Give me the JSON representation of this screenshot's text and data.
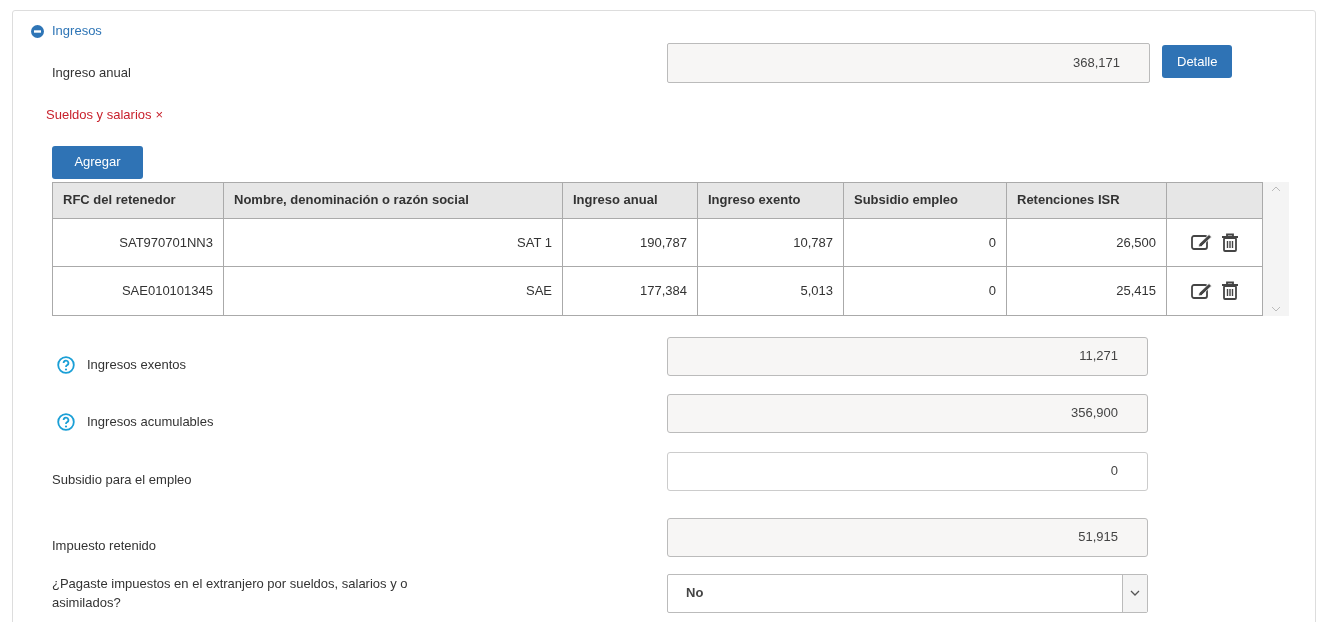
{
  "section": {
    "title": "Ingresos",
    "expanded": true
  },
  "annual": {
    "label": "Ingreso anual",
    "value": "368,171",
    "button": "Detalle"
  },
  "category": {
    "label": "Sueldos y salarios",
    "remove": "×"
  },
  "add_button": "Agregar",
  "table": {
    "columns": [
      "RFC del retenedor",
      "Nombre, denominación o razón social",
      "Ingreso anual",
      "Ingreso exento",
      "Subsidio empleo",
      "Retenciones ISR"
    ],
    "rows": [
      {
        "cells": [
          "SAT970701NN3",
          "SAT 1",
          "190,787",
          "10,787",
          "0",
          "26,500"
        ]
      },
      {
        "cells": [
          "SAE010101345",
          "SAE",
          "177,384",
          "5,013",
          "0",
          "25,415"
        ]
      }
    ]
  },
  "fields": [
    {
      "kind": "input",
      "label": "Ingresos exentos",
      "help": true,
      "readonly": true,
      "value": "11,271"
    },
    {
      "kind": "input",
      "label": "Ingresos acumulables",
      "help": true,
      "readonly": true,
      "value": "356,900"
    },
    {
      "kind": "input",
      "label": "Subsidio para el empleo",
      "help": false,
      "readonly": false,
      "value": "0"
    },
    {
      "kind": "input",
      "label": "Impuesto retenido",
      "help": false,
      "readonly": true,
      "value": "51,915"
    },
    {
      "kind": "select",
      "label": "¿Pagaste impuestos en el extranjero por sueldos, salarios y o asimilados?",
      "help": false,
      "value": "No"
    }
  ]
}
